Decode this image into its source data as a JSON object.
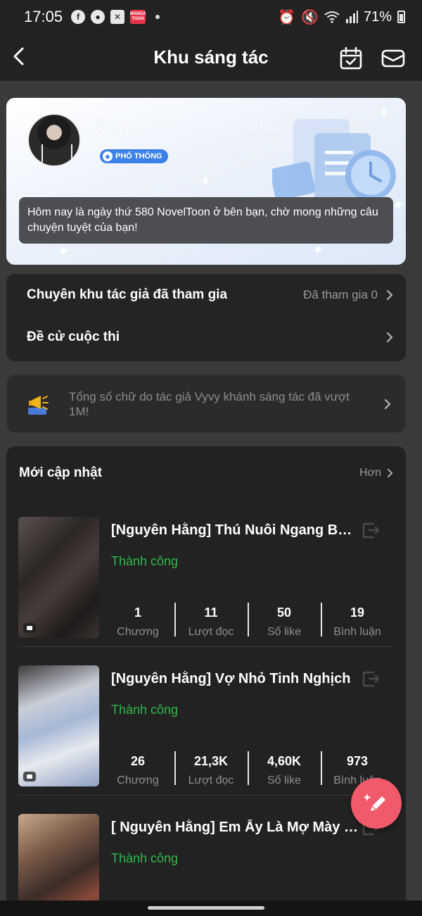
{
  "status_bar": {
    "time": "17:05",
    "left_icons": [
      "facebook-icon",
      "messenger-icon",
      "capcut-icon",
      "mangatoon-icon"
    ],
    "manga_icon_text": "MANGA TOON",
    "battery": "71%"
  },
  "header": {
    "title": "Khu sáng tác"
  },
  "profile": {
    "username": "ố quỷ nhà phong tuấn",
    "badge": "PHỔ THÔNG",
    "message": "Hôm nay là ngày thứ 580 NovelToon ở bên bạn, chờ mong những câu chuyện tuyệt của bạn!"
  },
  "menu": {
    "items": [
      {
        "label": "Chuyên khu tác giả đã tham gia",
        "value": "Đã tham gia 0"
      },
      {
        "label": "Đề cử cuộc thi",
        "value": ""
      }
    ]
  },
  "notice": {
    "text": "Tổng số chữ do tác giả Vyvy khánh sáng tác đã vượt 1M!"
  },
  "updates": {
    "title": "Mới cập nhật",
    "more": "Hơn",
    "stories": [
      {
        "title": "[Nguyên Hằng] Thú Nuôi Ngang Bướng",
        "status": "Thành công",
        "stats": [
          {
            "value": "1",
            "label": "Chương"
          },
          {
            "value": "11",
            "label": "Lượt đọc"
          },
          {
            "value": "50",
            "label": "Số like"
          },
          {
            "value": "19",
            "label": "Bình luận"
          }
        ]
      },
      {
        "title": "[Nguyên Hằng] Vợ Nhỏ Tinh Nghịch",
        "status": "Thành công",
        "stats": [
          {
            "value": "26",
            "label": "Chương"
          },
          {
            "value": "21,3K",
            "label": "Lượt đọc"
          },
          {
            "value": "4,60K",
            "label": "Số like"
          },
          {
            "value": "973",
            "label": "Bình luận"
          }
        ]
      },
      {
        "title": "[ Nguyên Hằng] Em Ấy Là Mợ Mày Đấy",
        "status": "Thành công",
        "stats": [
          {
            "value": "",
            "label": ""
          },
          {
            "value": "",
            "label": ""
          },
          {
            "value": "",
            "label": ""
          },
          {
            "value": "",
            "label": ""
          }
        ]
      }
    ]
  },
  "colors": {
    "header_bg": "#222222",
    "page_bg": "#3a3a3a",
    "success_green": "#2fb84a",
    "fab_pink": "#f05a6b",
    "badge_blue": "#3b82e8"
  }
}
